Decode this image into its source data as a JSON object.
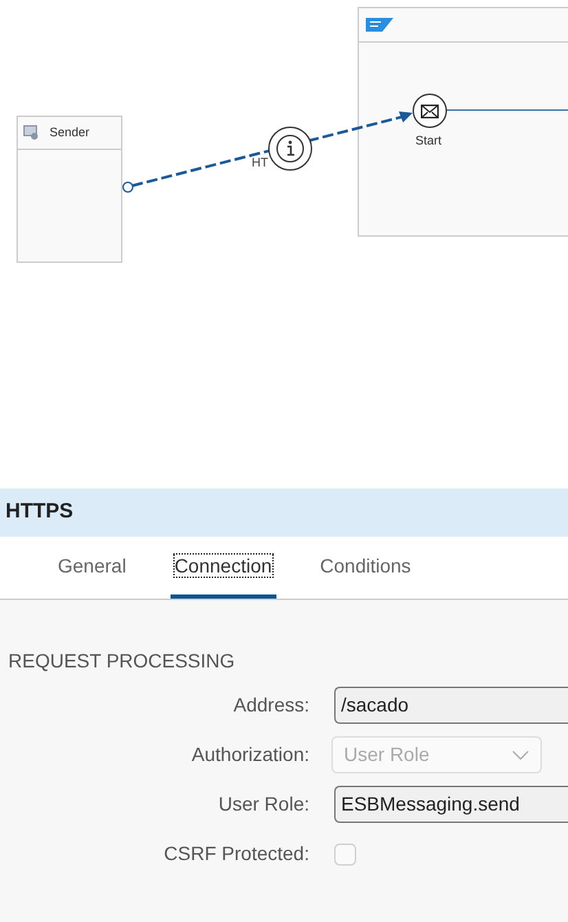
{
  "diagram": {
    "sender": {
      "name": "Sender"
    },
    "start_event": {
      "label": "Start"
    },
    "connection": {
      "label": "HT"
    }
  },
  "panel": {
    "title": "HTTPS",
    "tabs": [
      {
        "label": "General",
        "selected": false
      },
      {
        "label": "Connection",
        "selected": true
      },
      {
        "label": "Conditions",
        "selected": false
      }
    ],
    "section": "REQUEST PROCESSING",
    "fields": [
      {
        "kind": "input",
        "label": "Address:",
        "value": "/sacado",
        "disabled": false
      },
      {
        "kind": "select",
        "label": "Authorization:",
        "value": "User Role",
        "disabled": true
      },
      {
        "kind": "input",
        "label": "User Role:",
        "value": "ESBMessaging.send",
        "disabled": false
      },
      {
        "kind": "checkbox",
        "label": "CSRF Protected:",
        "checked": false,
        "disabled": true
      }
    ]
  }
}
